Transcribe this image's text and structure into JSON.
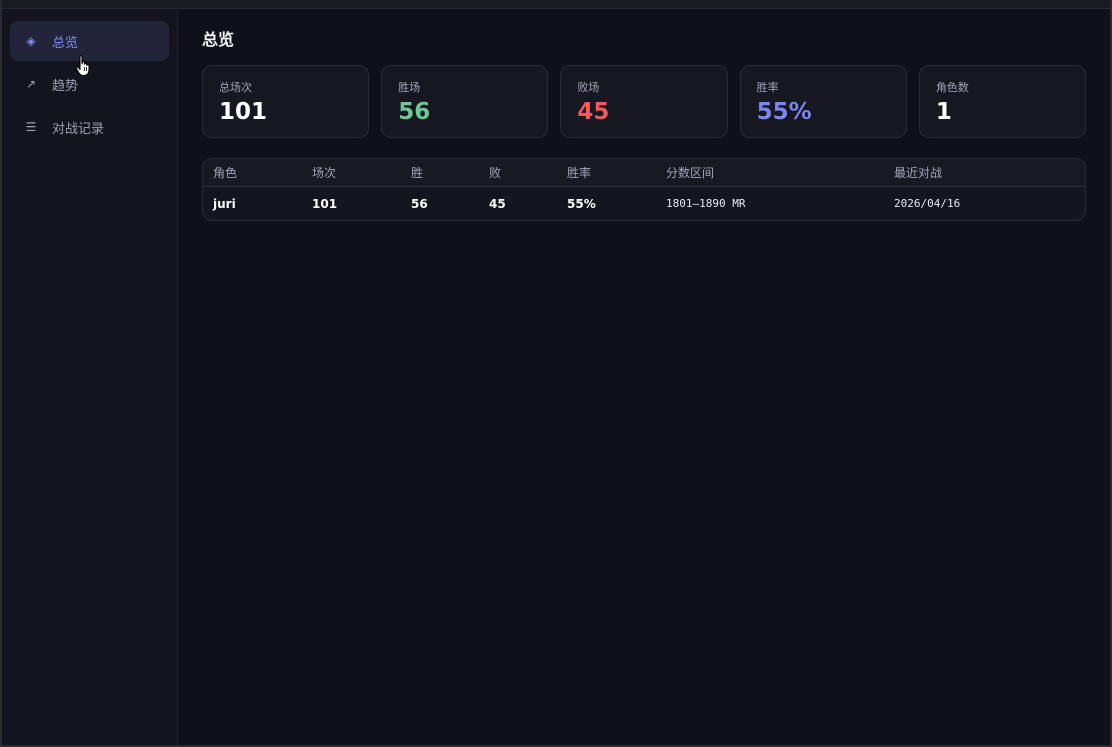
{
  "sidebar": {
    "items": [
      {
        "label": "总览",
        "icon": "diamond-icon",
        "glyph": "◈",
        "active": true
      },
      {
        "label": "趋势",
        "icon": "trend-arrow-icon",
        "glyph": "↗",
        "active": false
      },
      {
        "label": "对战记录",
        "icon": "list-icon",
        "glyph": "☰",
        "active": false
      }
    ]
  },
  "main": {
    "title": "总览",
    "cards": [
      {
        "label": "总场次",
        "value": "101",
        "color": "#ffffff"
      },
      {
        "label": "胜场",
        "value": "56",
        "color": "#6fc895"
      },
      {
        "label": "败场",
        "value": "45",
        "color": "#ef5b5b"
      },
      {
        "label": "胜率",
        "value": "55%",
        "color": "#7a86f2"
      },
      {
        "label": "角色数",
        "value": "1",
        "color": "#ffffff"
      }
    ],
    "table": {
      "headers": [
        "角色",
        "场次",
        "胜",
        "败",
        "胜率",
        "分数区间",
        "最近对战"
      ],
      "rows": [
        [
          "juri",
          "101",
          "56",
          "45",
          "55%",
          "1801–1890 MR",
          "2026/04/16"
        ]
      ]
    }
  },
  "colors": {
    "accent": "#7d8cf0",
    "win": "#6fc895",
    "loss": "#ef5b5b",
    "background": "#0f1019"
  }
}
